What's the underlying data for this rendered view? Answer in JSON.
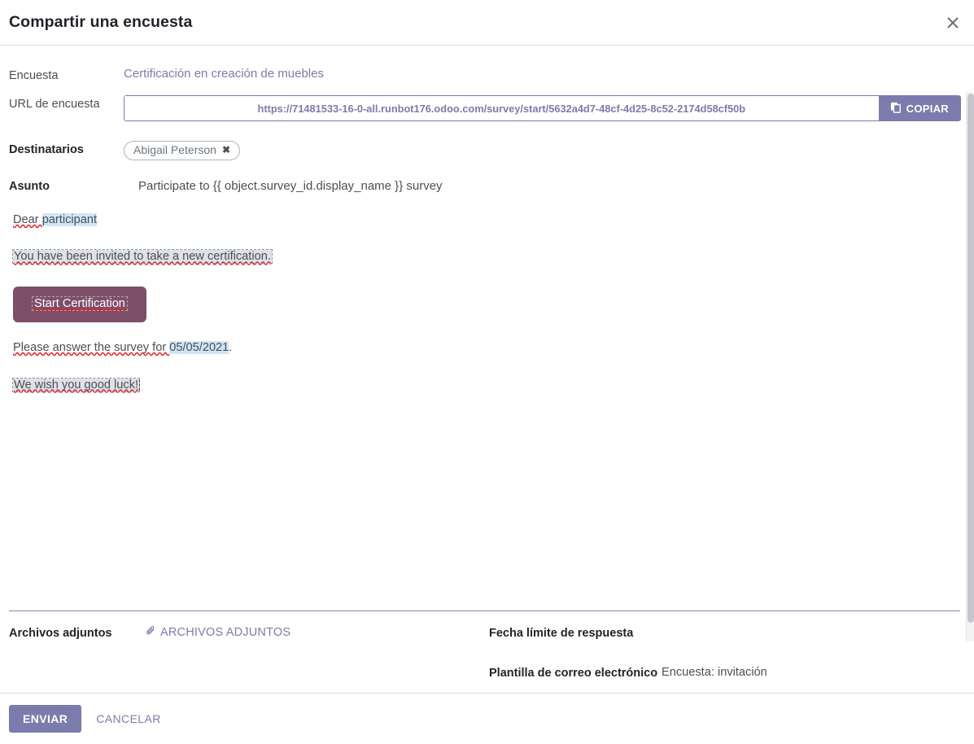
{
  "header": {
    "title": "Compartir una encuesta",
    "close_icon": "close-icon"
  },
  "fields": {
    "survey_label": "Encuesta",
    "survey_value": "Certificación en creación de muebles",
    "url_label": "URL de encuesta",
    "url_value": "https://71481533-16-0-all.runbot176.odoo.com/survey/start/5632a4d7-48cf-4d25-8c52-2174d58cf50b",
    "copy_label": "COPIAR",
    "copy_icon": "copy-icon",
    "recipients_label": "Destinatarios",
    "recipient_tag": "Abigail Peterson",
    "recipient_remove_icon": "remove-tag-icon",
    "subject_label": "Asunto",
    "subject_value": "Participate to {{ object.survey_id.display_name }} survey"
  },
  "mail_body": {
    "greeting_prefix": "Dear ",
    "greeting_highlight": "participant",
    "invite_line": "You have been invited to take a new certification.",
    "cta_label": "Start Certification",
    "answer_prefix": "Please answer the survey for ",
    "answer_date": "05/05/2021",
    "answer_suffix": ".",
    "wish_line": "We wish you good luck!"
  },
  "lower": {
    "attachments_label": "Archivos adjuntos",
    "attachments_action": "ARCHIVOS ADJUNTOS",
    "attachments_icon": "paperclip-icon",
    "deadline_label": "Fecha límite de respuesta",
    "deadline_value": "",
    "template_label": "Plantilla de correo electrónico",
    "template_value": "Encuesta: invitación"
  },
  "footer": {
    "send_label": "ENVIAR",
    "cancel_label": "CANCELAR"
  },
  "colors": {
    "accent": "#7C7BAD",
    "cta_button": "#7d4f68",
    "highlight_blue": "#cfe6f7",
    "highlight_grey": "#dfe1e8",
    "spellcheck": "#e02020"
  }
}
